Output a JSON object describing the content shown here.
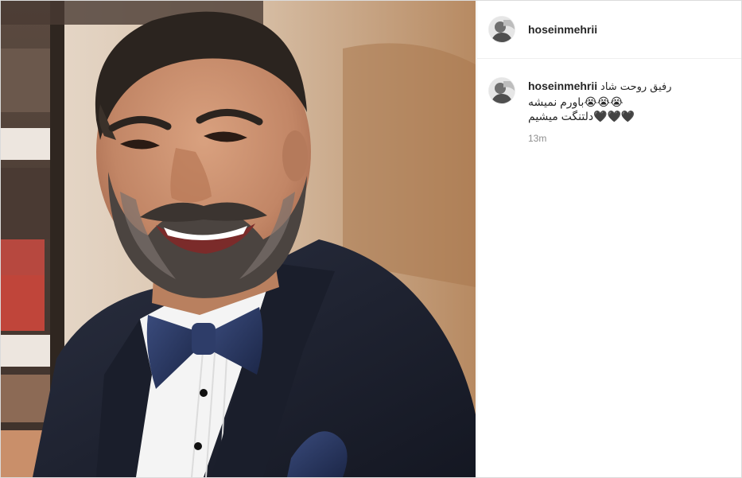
{
  "post": {
    "image_alt": "Smiling bearded man in a dark tuxedo with a navy bow tie and pocket square",
    "author": {
      "username": "hoseinmehrii",
      "avatar_icon": "profile-avatar-icon"
    }
  },
  "comment": {
    "username": "hoseinmehrii",
    "line1": "رفیق روحت شاد",
    "line2": "😭😭😭باورم نمیشه",
    "line3": "🖤🖤🖤دلتنگت میشیم",
    "time": "13m"
  },
  "colors": {
    "border": "#dbdbdb",
    "text": "#262626",
    "muted": "#8e8e8e",
    "suit": "#1e2230",
    "bowtie": "#26345c"
  }
}
